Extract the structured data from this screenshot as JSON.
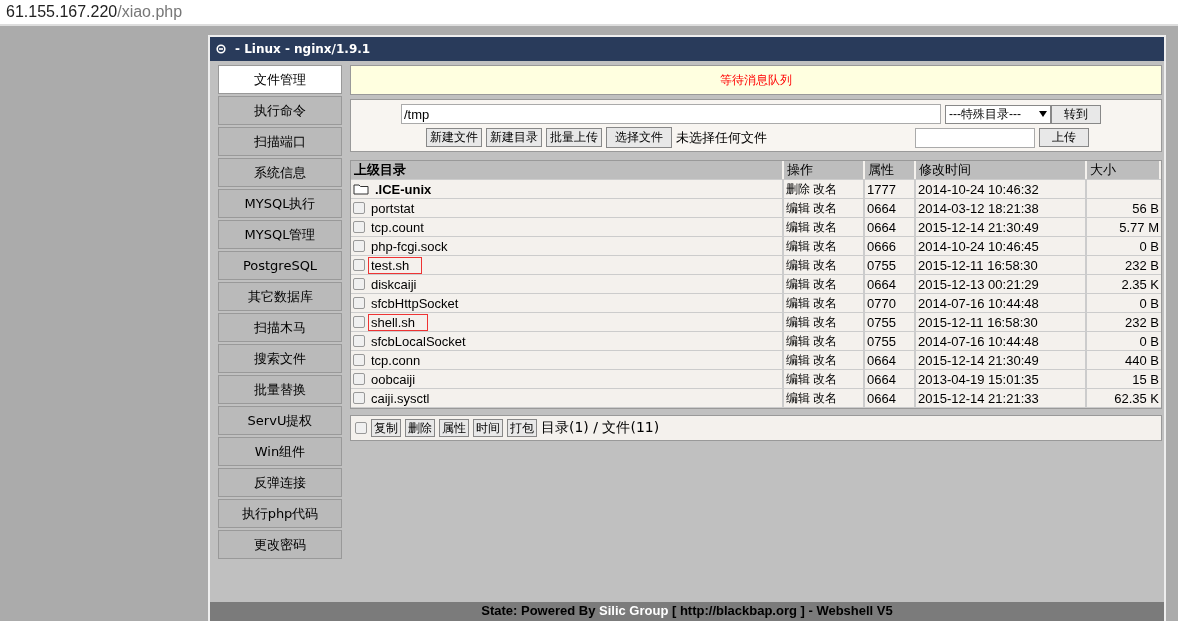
{
  "address_bar": {
    "host": "61.155.167.220",
    "path": "/xiao.php"
  },
  "window": {
    "title": "- Linux - nginx/1.9.1"
  },
  "sidebar": {
    "items": [
      {
        "label": "文件管理",
        "selected": true
      },
      {
        "label": "执行命令",
        "selected": false
      },
      {
        "label": "扫描端口",
        "selected": false
      },
      {
        "label": "系统信息",
        "selected": false
      },
      {
        "label": "MYSQL执行",
        "selected": false
      },
      {
        "label": "MYSQL管理",
        "selected": false
      },
      {
        "label": "PostgreSQL",
        "selected": false
      },
      {
        "label": "其它数据库",
        "selected": false
      },
      {
        "label": "扫描木马",
        "selected": false
      },
      {
        "label": "搜索文件",
        "selected": false
      },
      {
        "label": "批量替换",
        "selected": false
      },
      {
        "label": "ServU提权",
        "selected": false
      },
      {
        "label": "Win组件",
        "selected": false
      },
      {
        "label": "反弹连接",
        "selected": false
      },
      {
        "label": "执行php代码",
        "selected": false
      },
      {
        "label": "更改密码",
        "selected": false
      }
    ]
  },
  "message": "等待消息队列",
  "toolbar": {
    "path": "/tmp",
    "special_dir": "---特殊目录---",
    "goto": "转到",
    "buttons": [
      "新建文件",
      "新建目录",
      "批量上传"
    ],
    "choose_file": "选择文件",
    "no_file": "未选择任何文件",
    "upload": "上传"
  },
  "table": {
    "columns": [
      "上级目录",
      "操作",
      "属性",
      "修改时间",
      "大小"
    ],
    "rows": [
      {
        "kind": "folder",
        "name": ".ICE-unix",
        "actions": [
          "删除",
          "改名"
        ],
        "perm": "1777",
        "mtime": "2014-10-24 10:46:32"
      },
      {
        "kind": "file",
        "name": "portstat",
        "actions": [
          "编辑",
          "改名"
        ],
        "perm": "0664",
        "mtime": "2014-03-12 18:21:38",
        "size": "56 B",
        "checked": false,
        "highlighted": false
      },
      {
        "kind": "file",
        "name": "tcp.count",
        "actions": [
          "编辑",
          "改名"
        ],
        "perm": "0664",
        "mtime": "2015-12-14 21:30:49",
        "size": "5.77 M",
        "checked": false,
        "highlighted": false
      },
      {
        "kind": "file",
        "name": "php-fcgi.sock",
        "actions": [
          "编辑",
          "改名"
        ],
        "perm": "0666",
        "mtime": "2014-10-24 10:46:45",
        "size": "0 B",
        "checked": false,
        "highlighted": false
      },
      {
        "kind": "file",
        "name": "test.sh",
        "actions": [
          "编辑",
          "改名"
        ],
        "perm": "0755",
        "mtime": "2015-12-11 16:58:30",
        "size": "232 B",
        "checked": false,
        "highlighted": true
      },
      {
        "kind": "file",
        "name": "diskcaiji",
        "actions": [
          "编辑",
          "改名"
        ],
        "perm": "0664",
        "mtime": "2015-12-13 00:21:29",
        "size": "2.35 K",
        "checked": false,
        "highlighted": false
      },
      {
        "kind": "file",
        "name": "sfcbHttpSocket",
        "actions": [
          "编辑",
          "改名"
        ],
        "perm": "0770",
        "mtime": "2014-07-16 10:44:48",
        "size": "0 B",
        "checked": false,
        "highlighted": false
      },
      {
        "kind": "file",
        "name": "shell.sh",
        "actions": [
          "编辑",
          "改名"
        ],
        "perm": "0755",
        "mtime": "2015-12-11 16:58:30",
        "size": "232 B",
        "checked": false,
        "highlighted": true
      },
      {
        "kind": "file",
        "name": "sfcbLocalSocket",
        "actions": [
          "编辑",
          "改名"
        ],
        "perm": "0755",
        "mtime": "2014-07-16 10:44:48",
        "size": "0 B",
        "checked": false,
        "highlighted": false
      },
      {
        "kind": "file",
        "name": "tcp.conn",
        "actions": [
          "编辑",
          "改名"
        ],
        "perm": "0664",
        "mtime": "2015-12-14 21:30:49",
        "size": "440 B",
        "checked": false,
        "highlighted": false
      },
      {
        "kind": "file",
        "name": "oobcaiji",
        "actions": [
          "编辑",
          "改名"
        ],
        "perm": "0664",
        "mtime": "2013-04-19 15:01:35",
        "size": "15 B",
        "checked": false,
        "highlighted": false
      },
      {
        "kind": "file",
        "name": "caiji.sysctl",
        "actions": [
          "编辑",
          "改名"
        ],
        "perm": "0664",
        "mtime": "2015-12-14 21:21:33",
        "size": "62.35 K",
        "checked": false,
        "highlighted": false
      }
    ]
  },
  "bulk": {
    "checked": false,
    "buttons": [
      "复制",
      "删除",
      "属性",
      "时间",
      "打包"
    ],
    "summary": "目录(1) / 文件(11)"
  },
  "footer": {
    "prefix": "State: Powered By",
    "brand": "Silic Group",
    "suffix": "[ http://blackbap.org ] - Webshell V5"
  }
}
